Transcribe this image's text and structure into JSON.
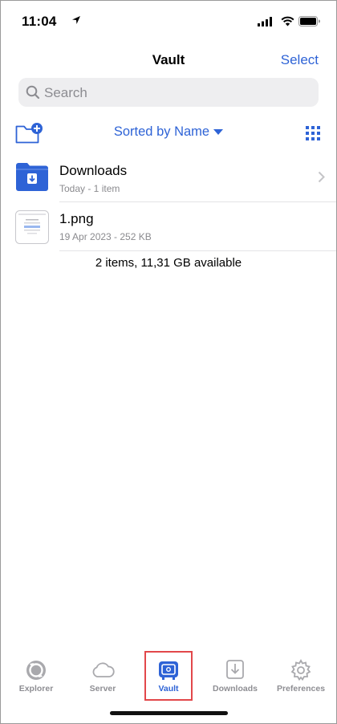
{
  "status": {
    "time": "11:04"
  },
  "nav": {
    "title": "Vault",
    "select_label": "Select"
  },
  "search": {
    "placeholder": "Search"
  },
  "toolbar": {
    "sort_label": "Sorted by Name"
  },
  "files": [
    {
      "name": "Downloads",
      "meta": "Today - 1 item",
      "icon": "folder-download-icon"
    },
    {
      "name": "1.png",
      "meta": "19 Apr 2023 - 252 KB",
      "icon": "image-thumbnail"
    }
  ],
  "summary": "2 items, 11,31 GB available",
  "tabs": [
    {
      "label": "Explorer",
      "icon": "explorer-icon"
    },
    {
      "label": "Server",
      "icon": "cloud-icon"
    },
    {
      "label": "Vault",
      "icon": "vault-icon",
      "active": true
    },
    {
      "label": "Downloads",
      "icon": "download-icon"
    },
    {
      "label": "Preferences",
      "icon": "gear-icon"
    }
  ],
  "colors": {
    "accent": "#2e63d6",
    "highlight": "#e2474a"
  }
}
